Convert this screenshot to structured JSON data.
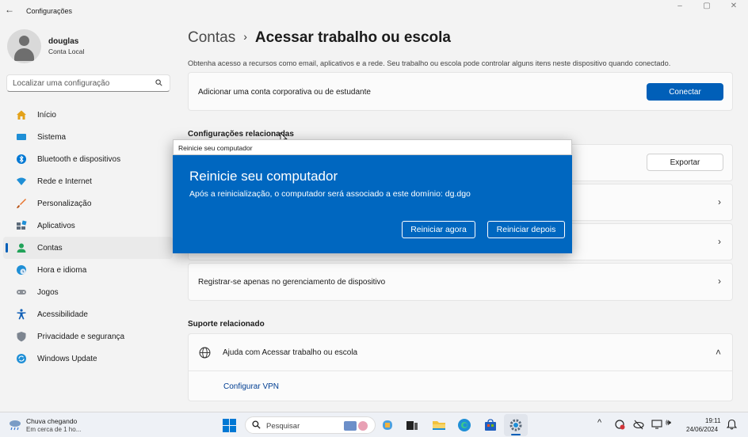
{
  "window": {
    "title": "Configurações",
    "back_glyph": "←",
    "minimize_glyph": "–",
    "maximize_glyph": "▢",
    "close_glyph": "✕"
  },
  "profile": {
    "name": "douglas",
    "account_type": "Conta Local"
  },
  "search": {
    "placeholder": "Localizar uma configuração",
    "icon": "search-icon"
  },
  "sidebar": {
    "items": [
      {
        "label": "Início",
        "icon": "home-icon",
        "color": "#e3a21a"
      },
      {
        "label": "Sistema",
        "icon": "system-icon",
        "color": "#1f8fd6"
      },
      {
        "label": "Bluetooth e dispositivos",
        "icon": "bluetooth-icon",
        "color": "#0078d4"
      },
      {
        "label": "Rede e Internet",
        "icon": "wifi-icon",
        "color": "#1f8fd6"
      },
      {
        "label": "Personalização",
        "icon": "brush-icon",
        "color": "#e8722b"
      },
      {
        "label": "Aplicativos",
        "icon": "apps-icon",
        "color": "#5d6b7a"
      },
      {
        "label": "Contas",
        "icon": "accounts-icon",
        "color": "#22a35a"
      },
      {
        "label": "Hora e idioma",
        "icon": "clock-globe-icon",
        "color": "#1f8fd6"
      },
      {
        "label": "Jogos",
        "icon": "gamepad-icon",
        "color": "#8a8f96"
      },
      {
        "label": "Acessibilidade",
        "icon": "accessibility-icon",
        "color": "#0d5db5"
      },
      {
        "label": "Privacidade e segurança",
        "icon": "shield-icon",
        "color": "#7d8590"
      },
      {
        "label": "Windows Update",
        "icon": "update-icon",
        "color": "#1f8fd6"
      }
    ],
    "active_index": 6
  },
  "main": {
    "breadcrumb_parent": "Contas",
    "breadcrumb_sep": "›",
    "page_title": "Acessar trabalho ou escola",
    "description": "Obtenha acesso a recursos como email, aplicativos e a rede. Seu trabalho ou escola pode controlar alguns itens neste dispositivo quando conectado.",
    "add_account_label": "Adicionar uma conta corporativa ou de estudante",
    "connect_button": "Conectar",
    "related_settings_title": "Configurações relacionadas",
    "export_button": "Exportar",
    "chevron_glyph": "›",
    "mdm_only_label": "Registrar-se apenas no gerenciamento de dispositivo",
    "related_support_title": "Suporte relacionado",
    "help_label": "Ajuda com Acessar trabalho ou escola",
    "help_expand_glyph": "˄",
    "vpn_link": "Configurar VPN"
  },
  "dialog": {
    "window_title": "Reinicie seu computador",
    "heading": "Reinicie seu computador",
    "message": "Após a reinicialização, o computador será associado a este domínio: dg.dgo",
    "restart_now": "Reiniciar agora",
    "restart_later": "Reiniciar depois",
    "accent": "#0067c0"
  },
  "taskbar": {
    "weather_title": "Chuva chegando",
    "weather_sub": "Em cerca de 1 ho...",
    "search_placeholder": "Pesquisar",
    "time": "19:11",
    "date": "24/06/2024",
    "chevron_up": "^",
    "speaker_glyph": "🕪",
    "bell_glyph": "🔔"
  }
}
